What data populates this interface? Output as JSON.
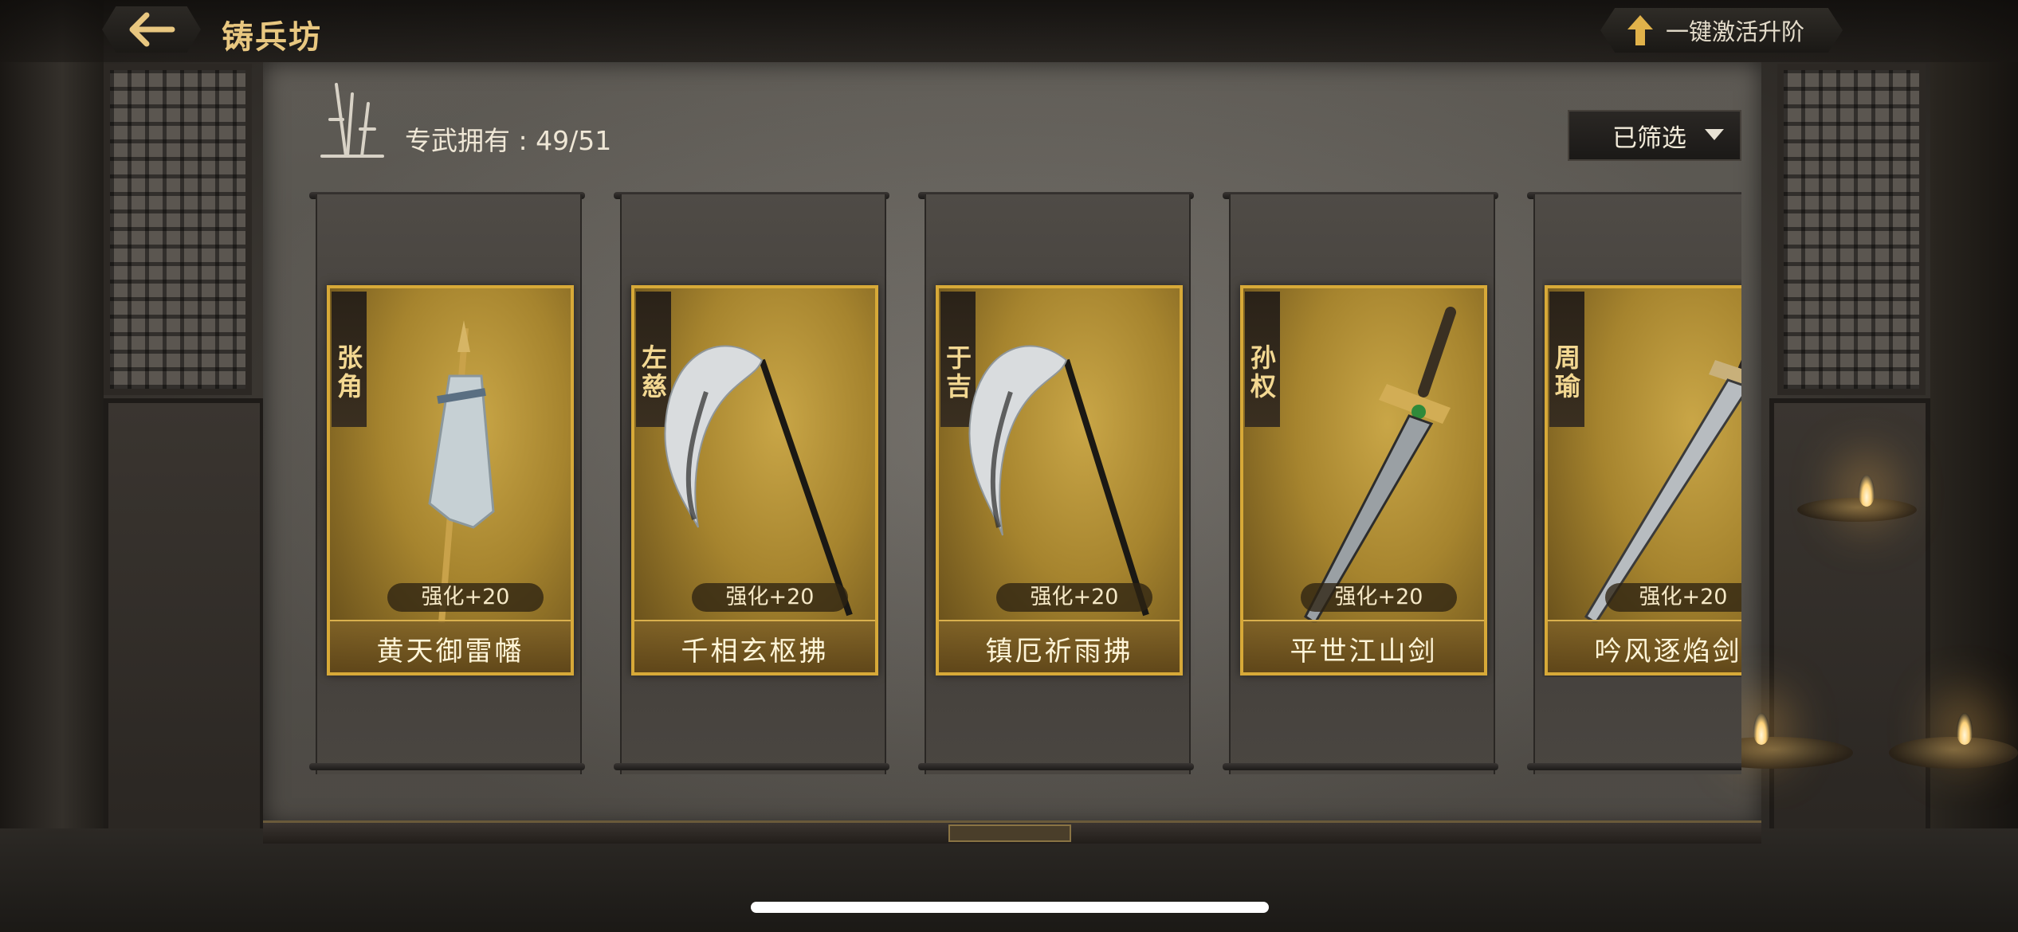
{
  "header": {
    "title": "铸兵坊",
    "activate_label": "一键激活升阶"
  },
  "collection": {
    "owned_label": "专武拥有 : 49/51"
  },
  "filter": {
    "label": "已筛选"
  },
  "weapons": [
    {
      "owner": "张角",
      "name": "黄天御雷幡",
      "level": "强化+20",
      "icon": "banner-icon"
    },
    {
      "owner": "左慈",
      "name": "千相玄枢拂",
      "level": "强化+20",
      "icon": "whisk-icon"
    },
    {
      "owner": "于吉",
      "name": "镇厄祈雨拂",
      "level": "强化+20",
      "icon": "whisk-icon"
    },
    {
      "owner": "孙权",
      "name": "平世江山剑",
      "level": "强化+20",
      "icon": "sword-icon"
    },
    {
      "owner": "周瑜",
      "name": "吟风逐焰剑",
      "level": "强化+20",
      "icon": "sword-icon"
    }
  ],
  "colors": {
    "gold": "#d7a938",
    "title": "#e8c780"
  }
}
